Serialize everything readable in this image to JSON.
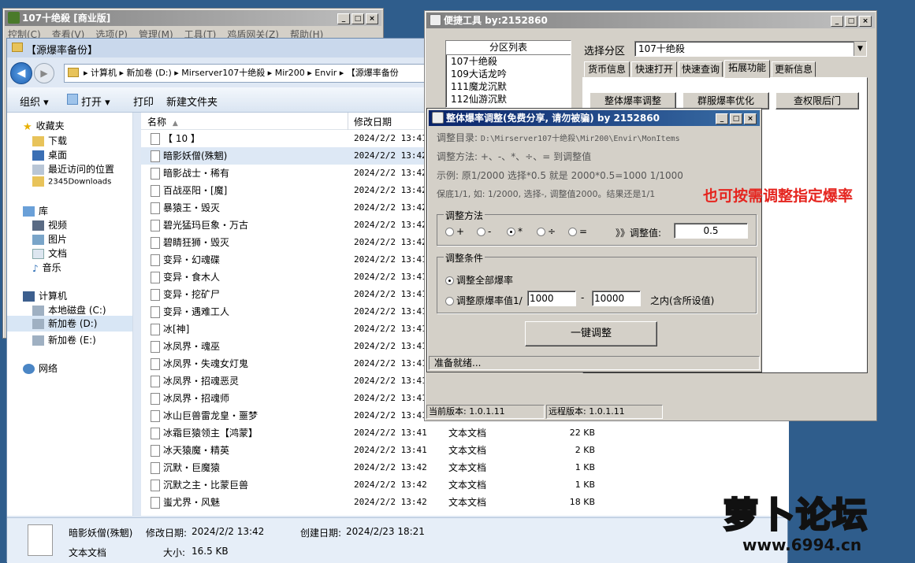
{
  "main_window": {
    "title": "107十绝殺 [商业版]",
    "menu": [
      "控制(C)",
      "查看(V)",
      "选项(P)",
      "管理(M)",
      "工具(T)",
      "鸡盾网关(Z)",
      "帮助(H)"
    ]
  },
  "explorer": {
    "title": "【源爆率备份】",
    "address": "▸ 计算机 ▸ 新加卷 (D:) ▸ Mirserver107十绝殺 ▸ Mir200 ▸ Envir ▸ 【源爆率备份",
    "toolbar": [
      "组织 ▾",
      "打开 ▾",
      "打印",
      "新建文件夹"
    ],
    "nav": {
      "favorites": "收藏夹",
      "fav_items": [
        "下载",
        "桌面",
        "最近访问的位置",
        "2345Downloads"
      ],
      "libraries": "库",
      "lib_items": [
        "视频",
        "图片",
        "文档",
        "音乐"
      ],
      "computer": "计算机",
      "drives": [
        "本地磁盘 (C:)",
        "新加卷 (D:)",
        "新加卷 (E:)"
      ],
      "network": "网络"
    },
    "columns": {
      "name": "名称",
      "date": "修改日期"
    },
    "files": [
      {
        "name": "【  10  】",
        "date": "2024/2/2 13:41",
        "type": "",
        "size": ""
      },
      {
        "name": "暗影妖僧(殊魍)",
        "date": "2024/2/2 13:42",
        "type": "",
        "size": ""
      },
      {
        "name": "暗影战士・稀有",
        "date": "2024/2/2 13:42",
        "type": "",
        "size": ""
      },
      {
        "name": "百战巫阳・[魔]",
        "date": "2024/2/2 13:42",
        "type": "",
        "size": ""
      },
      {
        "name": "暴猿王・毁灭",
        "date": "2024/2/2 13:42",
        "type": "",
        "size": ""
      },
      {
        "name": "碧光猛玛巨象・万古",
        "date": "2024/2/2 13:42",
        "type": "",
        "size": ""
      },
      {
        "name": "碧睛狂狮・毁灭",
        "date": "2024/2/2 13:42",
        "type": "",
        "size": ""
      },
      {
        "name": "变异・幻魂碟",
        "date": "2024/2/2 13:41",
        "type": "",
        "size": ""
      },
      {
        "name": "变异・食木人",
        "date": "2024/2/2 13:41",
        "type": "",
        "size": ""
      },
      {
        "name": "变异・挖矿尸",
        "date": "2024/2/2 13:41",
        "type": "",
        "size": ""
      },
      {
        "name": "变异・遇难工人",
        "date": "2024/2/2 13:41",
        "type": "",
        "size": ""
      },
      {
        "name": "冰[神]",
        "date": "2024/2/2 13:41",
        "type": "",
        "size": ""
      },
      {
        "name": "冰凤界・魂巫",
        "date": "2024/2/2 13:41",
        "type": "",
        "size": ""
      },
      {
        "name": "冰凤界・失魂女灯鬼",
        "date": "2024/2/2 13:41",
        "type": "",
        "size": ""
      },
      {
        "name": "冰凤界・招魂恶灵",
        "date": "2024/2/2 13:41",
        "type": "",
        "size": ""
      },
      {
        "name": "冰凤界・招魂师",
        "date": "2024/2/2 13:41",
        "type": "",
        "size": ""
      },
      {
        "name": "冰山巨兽雷龙皇・噩梦",
        "date": "2024/2/2 13:41",
        "type": "",
        "size": ""
      },
      {
        "name": "冰霜巨猿领主【鸿蒙】",
        "date": "2024/2/2 13:41",
        "type": "文本文档",
        "size": "22 KB"
      },
      {
        "name": "冰天猿魔・精英",
        "date": "2024/2/2 13:41",
        "type": "文本文档",
        "size": "2 KB"
      },
      {
        "name": "沉默・巨魔猿",
        "date": "2024/2/2 13:42",
        "type": "文本文档",
        "size": "1 KB"
      },
      {
        "name": "沉默之主・比蒙巨兽",
        "date": "2024/2/2 13:42",
        "type": "文本文档",
        "size": "1 KB"
      },
      {
        "name": "蚩尤界・风魅",
        "date": "2024/2/2 13:42",
        "type": "文本文档",
        "size": "18 KB"
      }
    ],
    "details": {
      "name": "暗影妖僧(殊魍)",
      "modified_label": "修改日期:",
      "modified": "2024/2/2 13:42",
      "created_label": "创建日期:",
      "created": "2024/2/23 18:21",
      "type": "文本文档",
      "size_label": "大小:",
      "size": "16.5 KB"
    }
  },
  "tools_window": {
    "title": "便捷工具  by:2152860",
    "zone_list_header": "分区列表",
    "zones": [
      "107十绝殺",
      "109大话龙吟",
      "111魔龙沉默",
      "112仙游沉默"
    ],
    "select_zone_label": "选择分区",
    "select_zone_value": "107十绝殺",
    "tabs": [
      "货币信息",
      "快速打开",
      "快速查询",
      "拓展功能",
      "更新信息"
    ],
    "active_tab": 3,
    "buttons": [
      "整体爆率调整",
      "群服爆率优化",
      "查权限后门"
    ],
    "status_current": "当前版本: 1.0.1.11",
    "status_remote": "远程版本: 1.0.1.11"
  },
  "dialog": {
    "title": "整体爆率调整(免费分享, 请勿被骗)   by 2152860",
    "dir_label": "调整目录:",
    "dir_value": "D:\\Mirserver107十绝殺\\Mir200\\Envir\\MonItems",
    "method_desc": "调整方法: +、-、*、÷、= 到调整值",
    "example": "示例: 原1/2000 选择*0.5 就是 2000*0.5=1000  1/1000",
    "floor": "保底1/1, 如: 1/2000, 选择-, 调整值2000。结果还是1/1",
    "method_group": "调整方法",
    "ops": [
      "+",
      "-",
      "*",
      "÷",
      "="
    ],
    "selected_op": 2,
    "adjust_label": "》》调整值:",
    "adjust_value": "0.5",
    "cond_group": "调整条件",
    "cond_all": "调整全部爆率",
    "cond_range": "调整原爆率值1/",
    "range_min": "1000",
    "range_dash": "-",
    "range_max": "10000",
    "range_suffix": "之内(含所设值)",
    "run_button": "一键调整",
    "status": "准备就绪..."
  },
  "annotation": "也可按需调整指定爆率",
  "watermark": {
    "text": "萝卜论坛",
    "url": "www.6994.cn"
  },
  "colors": {
    "title_active": "#0a246a",
    "annotation_red": "#e5251f",
    "selected_row": "#cce8ff"
  }
}
